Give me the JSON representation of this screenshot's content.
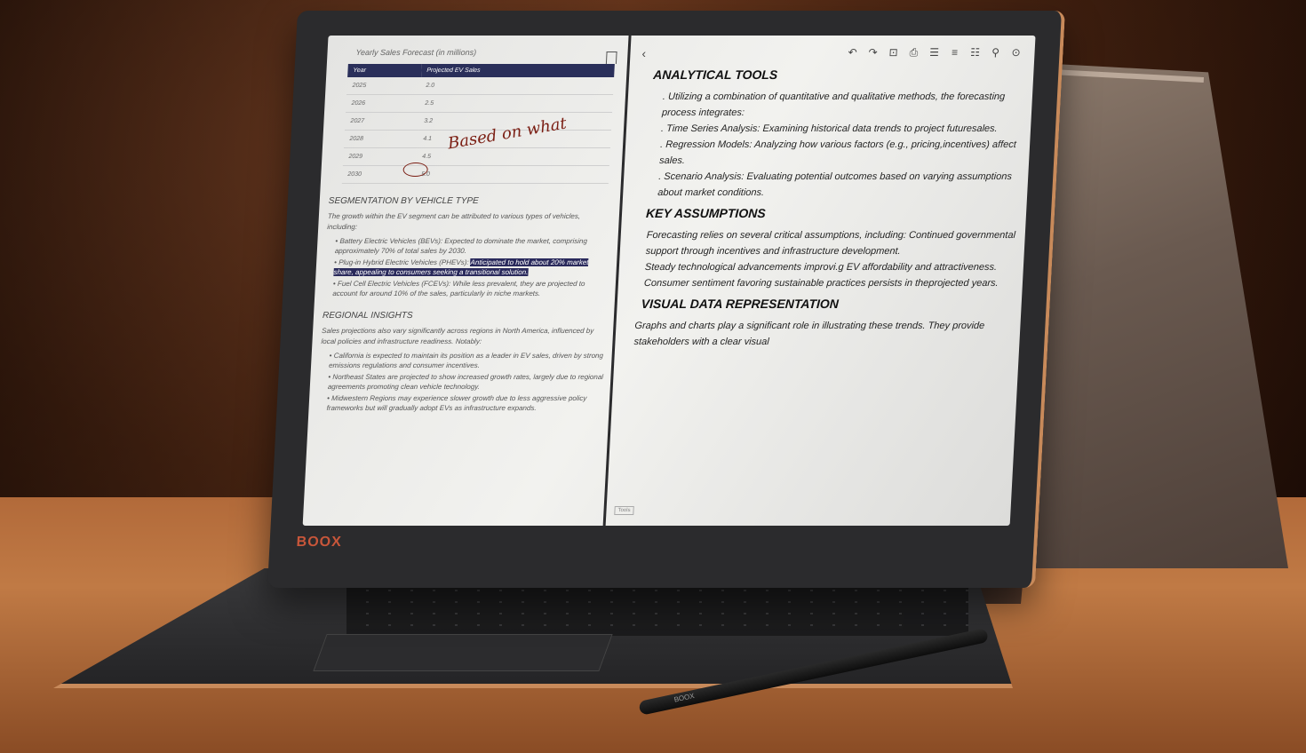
{
  "left_pane": {
    "table_title": "Yearly Sales Forecast (in millions)",
    "columns": [
      "Year",
      "Projected EV Sales"
    ],
    "rows": [
      [
        "2025",
        "2.0"
      ],
      [
        "2026",
        "2.5"
      ],
      [
        "2027",
        "3.2"
      ],
      [
        "2028",
        "4.1"
      ],
      [
        "2029",
        "4.5"
      ],
      [
        "2030",
        "5.0"
      ]
    ],
    "handwritten_note": "Based on what",
    "seg_heading": "SEGMENTATION BY VEHICLE TYPE",
    "seg_intro": "The growth within the EV segment can be attributed to various types of vehicles, including:",
    "bev": "• Battery Electric Vehicles (BEVs): Expected to dominate the market, comprising approximately 70% of total sales by 2030.",
    "phev_a": "• Plug-in Hybrid Electric Vehicles (PHEVs): ",
    "phev_b": "Anticipated to hold about 20% market share, appealing to consumers seeking a transitional solution.",
    "fcev": "• Fuel Cell Electric Vehicles (FCEVs): While less prevalent, they are projected to account for around 10% of the sales, particularly in niche markets.",
    "reg_heading": "REGIONAL INSIGHTS",
    "reg_intro": "Sales projections also vary significantly across regions in North America, influenced by local policies and infrastructure readiness. Notably:",
    "ca": "• California is expected to maintain its position as a leader in EV sales, driven by strong emissions regulations and consumer incentives.",
    "ne": "• Northeast States are projected to show increased growth rates, largely due to regional agreements promoting clean vehicle technology.",
    "mw": "• Midwestern Regions may experience slower growth due to less aggressive policy frameworks but will gradually adopt EVs as infrastructure expands."
  },
  "right_pane": {
    "h1": "ANALYTICAL TOOLS",
    "p1": ". Utilizing a combination of quantitative and qualitative methods, the forecasting process integrates:",
    "p2": ". Time Series Analysis: Examining historical data trends to project futuresales.",
    "p3": ". Regression Models: Analyzing how various factors (e.g., pricing,incentives) affect sales.",
    "p4": ". Scenario Analysis: Evaluating potential outcomes based on varying assumptions about market conditions.",
    "h2": "KEY ASSUMPTIONS",
    "p5": "Forecasting relies on several critical assumptions, including: Continued governmental support through incentives and infrastructure development.",
    "p6": "Steady technological advancements improvi.g EV affordability and attractiveness.",
    "p7": "Consumer sentiment favoring sustainable practices persists in theprojected years.",
    "h3": "VISUAL DATA REPRESENTATION",
    "p8": "Graphs and charts play a significant role in illustrating these trends. They provide stakeholders with a clear visual"
  },
  "toolbar": {
    "back": "‹",
    "undo": "↶",
    "redo": "↷",
    "i1": "⊡",
    "i2": "⎙",
    "i3": "☰",
    "i4": "≡",
    "i5": "☷",
    "link": "⚲",
    "more": "⊙"
  },
  "brand": "BOOX",
  "page_tag": "Tools",
  "pen_label": "BOOX"
}
